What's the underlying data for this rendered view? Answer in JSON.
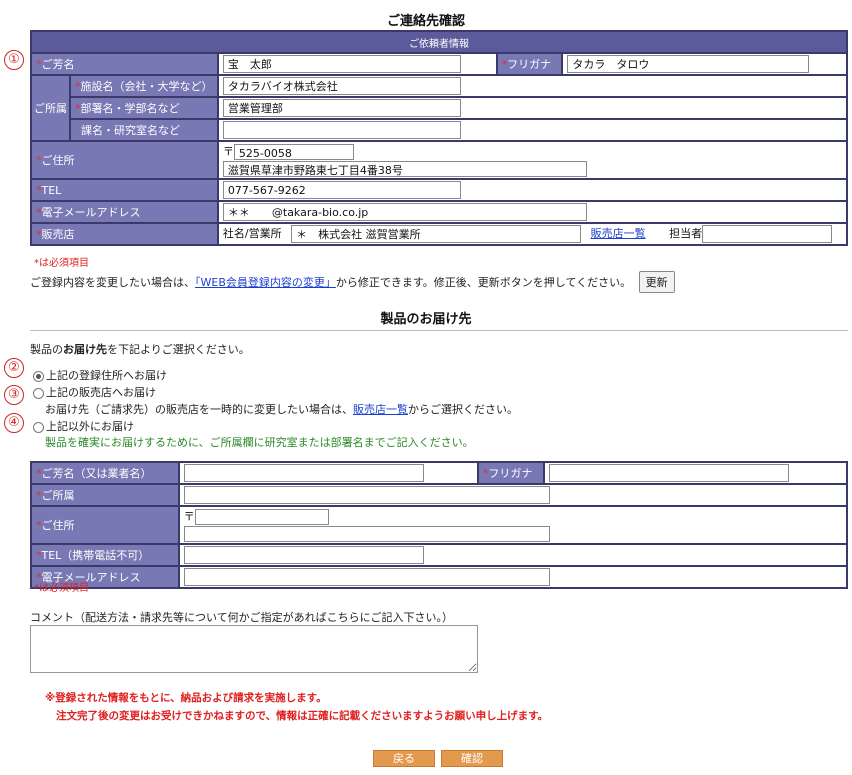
{
  "contact": {
    "title": "ご連絡先確認",
    "header": "ご依頼者情報",
    "markers": [
      "①",
      "②",
      "③",
      "④"
    ],
    "req_mark": "*",
    "name_label": "ご芳名",
    "name_value": "宝　太郎",
    "kana_label": "フリガナ",
    "kana_value": "タカラ　タロウ",
    "affil_label": "ご所属",
    "facility_label": "施設名（会社・大学など）",
    "facility_value": "タカラバイオ株式会社",
    "dept_label": "部署名・学部名など",
    "dept_value": "営業管理部",
    "lab_label": "課名・研究室名など",
    "lab_value": "",
    "address_label": "ご住所",
    "postal_mark": "〒",
    "postal_value": "525-0058",
    "address_value": "滋賀県草津市野路東七丁目4番38号",
    "tel_label": "TEL",
    "tel_value": "077-567-9262",
    "email_label": "電子メールアドレス",
    "email_value": "＊＊　　@takara-bio.co.jp",
    "dealer_label": "販売店",
    "dealer_company_label": "社名/営業所",
    "dealer_value": "＊　株式会社 滋賀営業所",
    "dealer_list_link": "販売店一覧",
    "person_label": "担当者",
    "required_note": "*は必須項目",
    "change_text_before": "ご登録内容を変更したい場合は、",
    "change_link": "「WEB会員登録内容の変更」",
    "change_text_after": "から修正できます。修正後、更新ボタンを押してください。",
    "update_button": "更新"
  },
  "delivery": {
    "title": "製品のお届け先",
    "instruction_before": "製品の",
    "instruction_bold": "お届け先",
    "instruction_after": "を下記よりご選択ください。",
    "options": [
      {
        "label": "上記の登録住所へお届け",
        "selected": true
      },
      {
        "label": "上記の販売店へお届け",
        "selected": false
      },
      {
        "label": "上記以外にお届け",
        "selected": false
      }
    ],
    "option2_note_before": "お届け先（ご請求先）の販売店を一時的に変更したい場合は、",
    "option2_note_link": "販売店一覧",
    "option2_note_after": "からご選択ください。",
    "option3_note": "製品を確実にお届けするために、ご所属欄に研究室または部署名までご記入ください。",
    "form": {
      "name_label": "ご芳名（又は業者名）",
      "kana_label": "フリガナ",
      "affil_label": "ご所属",
      "address_label": "ご住所",
      "postal_mark": "〒",
      "tel_label": "TEL（携帯電話不可）",
      "email_label": "電子メールアドレス"
    },
    "required_note": "*は必須項目",
    "comment_label": "コメント（配送方法・請求先等について何かご指定があればこちらにご記入下さい。）",
    "notice_line1": "※登録された情報をもとに、納品および請求を実施します。",
    "notice_line2": "注文完了後の変更はお受けできかねますので、情報は正確に記載くださいますようお願い申し上げます。",
    "back_button": "戻る",
    "confirm_button": "確認"
  }
}
